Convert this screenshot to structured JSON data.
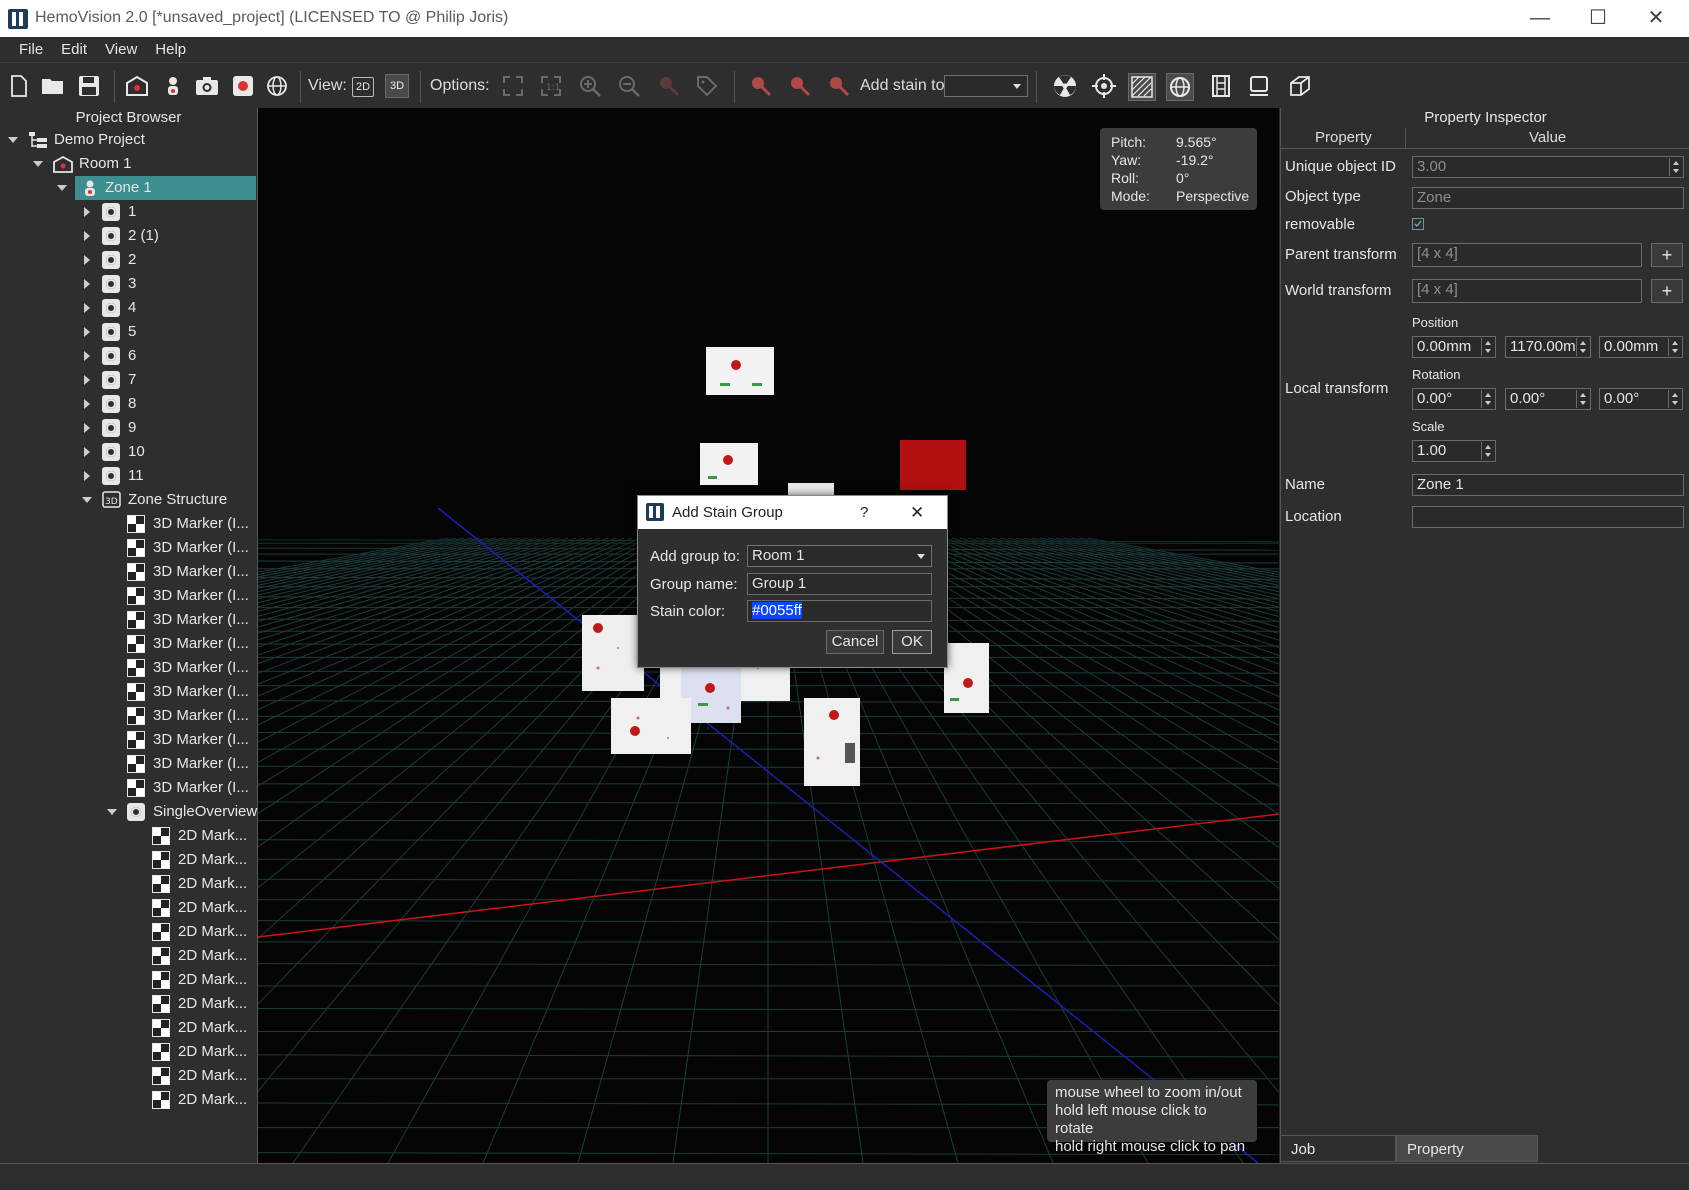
{
  "window": {
    "title": "HemoVision 2.0 [*unsaved_project] (LICENSED TO @ Philip Joris)",
    "minimize": "—",
    "maximize": "☐",
    "close": "✕"
  },
  "menu": [
    "File",
    "Edit",
    "View",
    "Help"
  ],
  "toolbar": {
    "view_label": "View:",
    "view_2d": "2D",
    "view_3d": "3D",
    "options_label": "Options:",
    "add_stain_label": "Add stain to:",
    "add_stain_value": ""
  },
  "project_browser": {
    "title": "Project Browser",
    "root": "Demo Project",
    "room": "Room 1",
    "zone": "Zone 1",
    "cameras": [
      "1",
      "2 (1)",
      "2",
      "3",
      "4",
      "5",
      "6",
      "7",
      "8",
      "9",
      "10",
      "11"
    ],
    "zone_structure": "Zone Structure",
    "markers_3d": [
      "3D Marker (I...",
      "3D Marker (I...",
      "3D Marker (I...",
      "3D Marker (I...",
      "3D Marker (I...",
      "3D Marker (I...",
      "3D Marker (I...",
      "3D Marker (I...",
      "3D Marker (I...",
      "3D Marker (I...",
      "3D Marker (I...",
      "3D Marker (I..."
    ],
    "overview": "SingleOverview",
    "markers_2d": [
      "2D Mark...",
      "2D Mark...",
      "2D Mark...",
      "2D Mark...",
      "2D Mark...",
      "2D Mark...",
      "2D Mark...",
      "2D Mark...",
      "2D Mark...",
      "2D Mark...",
      "2D Mark...",
      "2D Mark..."
    ]
  },
  "hud": {
    "pitch_label": "Pitch:",
    "pitch": "9.565°",
    "yaw_label": "Yaw:",
    "yaw": "-19.2°",
    "roll_label": "Roll:",
    "roll": "0°",
    "mode_label": "Mode:",
    "mode": "Perspective"
  },
  "hint": {
    "line1": "mouse wheel to zoom in/out",
    "line2": "hold left mouse click to rotate",
    "line3": "hold right mouse click to pan"
  },
  "inspector": {
    "title": "Property Inspector",
    "col_property": "Property",
    "col_value": "Value",
    "unique_id_label": "Unique object ID",
    "unique_id": "3.00",
    "object_type_label": "Object type",
    "object_type": "Zone",
    "removable_label": "removable",
    "parent_transform_label": "Parent transform",
    "parent_transform": "[4 x 4]",
    "world_transform_label": "World transform",
    "world_transform": "[4 x 4]",
    "local_transform_label": "Local transform",
    "position_label": "Position",
    "pos_x": "0.00mm",
    "pos_y": "1170.00m",
    "pos_z": "0.00mm",
    "rotation_label": "Rotation",
    "rot_x": "0.00°",
    "rot_y": "0.00°",
    "rot_z": "0.00°",
    "scale_label": "Scale",
    "scale": "1.00",
    "name_label": "Name",
    "name": "Zone 1",
    "location_label": "Location",
    "location": ""
  },
  "tabs": {
    "job_dispatcher": "Job Dispatcher",
    "property_inspector": "Property Inspector"
  },
  "dialog": {
    "title": "Add Stain Group",
    "help": "?",
    "close": "✕",
    "add_group_label": "Add group to:",
    "add_group_value": "Room 1",
    "group_name_label": "Group name:",
    "group_name_value": "Group 1",
    "stain_color_label": "Stain color:",
    "stain_color_value": "#0055ff",
    "cancel": "Cancel",
    "ok": "OK"
  },
  "colors": {
    "selection": "#3d8f8f",
    "stain_color": "#0055ff",
    "grid": "#1d3b3b",
    "axis_x": "#c81414",
    "axis_z": "#1e1eb4"
  }
}
